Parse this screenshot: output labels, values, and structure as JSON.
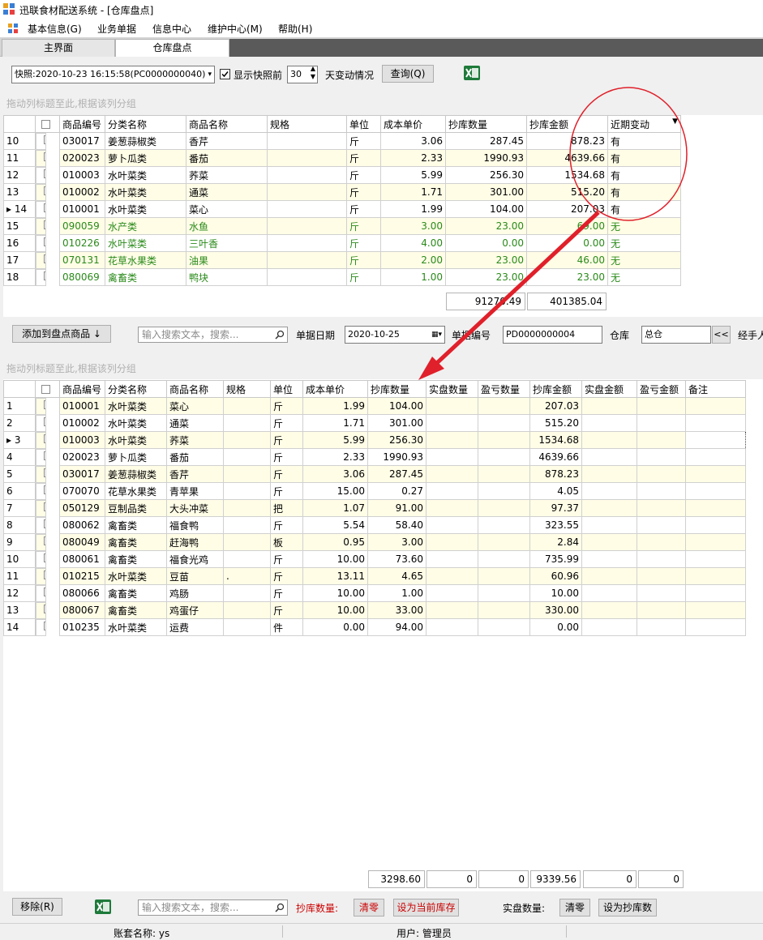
{
  "window": {
    "title": "迅联食材配送系统 - [仓库盘点]"
  },
  "menu": [
    "基本信息(G)",
    "业务单据",
    "信息中心",
    "维护中心(M)",
    "帮助(H)"
  ],
  "tabs": [
    "主界面",
    "仓库盘点"
  ],
  "top_toolbar": {
    "snapshot": "快照:2020-10-23 16:15:58(PC0000000040)",
    "show_snapshot_label": "显示快照前",
    "days_value": "30",
    "days_suffix": "天变动情况",
    "query_button": "查询(Q)"
  },
  "group_hint": "拖动列标题至此,根据该列分组",
  "top_grid": {
    "headers": [
      "商品编号",
      "分类名称",
      "商品名称",
      "规格",
      "单位",
      "成本单价",
      "抄库数量",
      "抄库金额",
      "近期变动"
    ],
    "rows": [
      {
        "rn": "10",
        "code": "030017",
        "cat": "姜葱蒜椒类",
        "name": "香芹",
        "spec": "",
        "unit": "斤",
        "price": "3.06",
        "qty": "287.45",
        "amt": "878.23",
        "chg": "有"
      },
      {
        "rn": "11",
        "code": "020023",
        "cat": "萝卜瓜类",
        "name": "番茄",
        "spec": "",
        "unit": "斤",
        "price": "2.33",
        "qty": "1990.93",
        "amt": "4639.66",
        "chg": "有"
      },
      {
        "rn": "12",
        "code": "010003",
        "cat": "水叶菜类",
        "name": "荞菜",
        "spec": "",
        "unit": "斤",
        "price": "5.99",
        "qty": "256.30",
        "amt": "1534.68",
        "chg": "有"
      },
      {
        "rn": "13",
        "code": "010002",
        "cat": "水叶菜类",
        "name": "通菜",
        "spec": "",
        "unit": "斤",
        "price": "1.71",
        "qty": "301.00",
        "amt": "515.20",
        "chg": "有"
      },
      {
        "rn": "▸ 14",
        "code": "010001",
        "cat": "水叶菜类",
        "name": "菜心",
        "spec": "",
        "unit": "斤",
        "price": "1.99",
        "qty": "104.00",
        "amt": "207.03",
        "chg": "有"
      },
      {
        "rn": "15",
        "code": "090059",
        "cat": "水产类",
        "name": "水鱼",
        "spec": "",
        "unit": "斤",
        "price": "3.00",
        "qty": "23.00",
        "amt": "69.00",
        "chg": "无"
      },
      {
        "rn": "16",
        "code": "010226",
        "cat": "水叶菜类",
        "name": "三叶香",
        "spec": "",
        "unit": "斤",
        "price": "4.00",
        "qty": "0.00",
        "amt": "0.00",
        "chg": "无"
      },
      {
        "rn": "17",
        "code": "070131",
        "cat": "花草水果类",
        "name": "油果",
        "spec": "",
        "unit": "斤",
        "price": "2.00",
        "qty": "23.00",
        "amt": "46.00",
        "chg": "无"
      },
      {
        "rn": "18",
        "code": "080069",
        "cat": "禽畜类",
        "name": "鸭块",
        "spec": "",
        "unit": "斤",
        "price": "1.00",
        "qty": "23.00",
        "amt": "23.00",
        "chg": "无"
      }
    ],
    "sum_qty": "91270.49",
    "sum_amt": "401385.04"
  },
  "mid_toolbar": {
    "add_button": "添加到盘点商品 ↓",
    "search_placeholder": "输入搜索文本，搜索...",
    "date_label": "单据日期",
    "date_value": "2020-10-25",
    "no_label": "单据编号",
    "no_value": "PD0000000004",
    "wh_label": "仓库",
    "wh_value": "总仓",
    "wh_btn": "<<",
    "handler_label": "经手人"
  },
  "bottom_grid": {
    "headers": [
      "商品编号",
      "分类名称",
      "商品名称",
      "规格",
      "单位",
      "成本单价",
      "抄库数量",
      "实盘数量",
      "盈亏数量",
      "抄库金额",
      "实盘金额",
      "盈亏金额",
      "备注"
    ],
    "rows": [
      {
        "rn": "1",
        "code": "010001",
        "cat": "水叶菜类",
        "name": "菜心",
        "spec": "",
        "unit": "斤",
        "price": "1.99",
        "qty": "104.00",
        "amt": "207.03"
      },
      {
        "rn": "2",
        "code": "010002",
        "cat": "水叶菜类",
        "name": "通菜",
        "spec": "",
        "unit": "斤",
        "price": "1.71",
        "qty": "301.00",
        "amt": "515.20"
      },
      {
        "rn": "▸ 3",
        "code": "010003",
        "cat": "水叶菜类",
        "name": "荞菜",
        "spec": "",
        "unit": "斤",
        "price": "5.99",
        "qty": "256.30",
        "amt": "1534.68"
      },
      {
        "rn": "4",
        "code": "020023",
        "cat": "萝卜瓜类",
        "name": "番茄",
        "spec": "",
        "unit": "斤",
        "price": "2.33",
        "qty": "1990.93",
        "amt": "4639.66"
      },
      {
        "rn": "5",
        "code": "030017",
        "cat": "姜葱蒜椒类",
        "name": "香芹",
        "spec": "",
        "unit": "斤",
        "price": "3.06",
        "qty": "287.45",
        "amt": "878.23"
      },
      {
        "rn": "6",
        "code": "070070",
        "cat": "花草水果类",
        "name": "青苹果",
        "spec": "",
        "unit": "斤",
        "price": "15.00",
        "qty": "0.27",
        "amt": "4.05"
      },
      {
        "rn": "7",
        "code": "050129",
        "cat": "豆制品类",
        "name": "大头冲菜",
        "spec": "",
        "unit": "把",
        "price": "1.07",
        "qty": "91.00",
        "amt": "97.37"
      },
      {
        "rn": "8",
        "code": "080062",
        "cat": "禽畜类",
        "name": "福食鸭",
        "spec": "",
        "unit": "斤",
        "price": "5.54",
        "qty": "58.40",
        "amt": "323.55"
      },
      {
        "rn": "9",
        "code": "080049",
        "cat": "禽畜类",
        "name": "赶海鸭",
        "spec": "",
        "unit": "板",
        "price": "0.95",
        "qty": "3.00",
        "amt": "2.84"
      },
      {
        "rn": "10",
        "code": "080061",
        "cat": "禽畜类",
        "name": "福食光鸡",
        "spec": "",
        "unit": "斤",
        "price": "10.00",
        "qty": "73.60",
        "amt": "735.99"
      },
      {
        "rn": "11",
        "code": "010215",
        "cat": "水叶菜类",
        "name": "豆苗",
        "spec": ".",
        "unit": "斤",
        "price": "13.11",
        "qty": "4.65",
        "amt": "60.96"
      },
      {
        "rn": "12",
        "code": "080066",
        "cat": "禽畜类",
        "name": "鸡肠",
        "spec": "",
        "unit": "斤",
        "price": "10.00",
        "qty": "1.00",
        "amt": "10.00"
      },
      {
        "rn": "13",
        "code": "080067",
        "cat": "禽畜类",
        "name": "鸡蛋仔",
        "spec": "",
        "unit": "斤",
        "price": "10.00",
        "qty": "33.00",
        "amt": "330.00"
      },
      {
        "rn": "14",
        "code": "010235",
        "cat": "水叶菜类",
        "name": "运费",
        "spec": "",
        "unit": "件",
        "price": "0.00",
        "qty": "94.00",
        "amt": "0.00"
      }
    ],
    "sums": [
      "3298.60",
      "0",
      "0",
      "9339.56",
      "0",
      "0"
    ]
  },
  "bottom_toolbar": {
    "remove_button": "移除(R)",
    "search_placeholder": "输入搜索文本，搜索...",
    "book_qty_label": "抄库数量:",
    "clear_button": "清零",
    "set_current_button": "设为当前库存",
    "real_qty_label": "实盘数量:",
    "clear_button2": "清零",
    "set_book_button": "设为抄库数"
  },
  "status": {
    "account": "账套名称: ys",
    "user": "用户: 管理员"
  },
  "colors": {
    "annotation_red": "#e0202a",
    "alt_row": "#fffde6",
    "green_text": "#2a8a1a",
    "tab_dark": "#5a5a5a"
  }
}
